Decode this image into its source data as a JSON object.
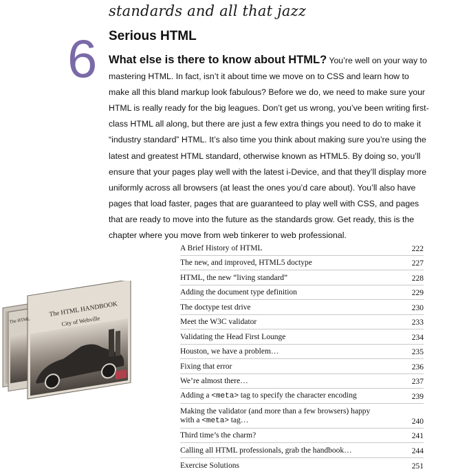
{
  "chapter": {
    "tagline": "standards and all that jazz",
    "number": "6",
    "title": "Serious HTML"
  },
  "intro": {
    "lead": "What else is there to know about HTML?",
    "body": " You’re well on your way to mastering HTML. In fact, isn’t it about time we move on to CSS and learn how to make all this bland markup look fabulous? Before we do, we need to make sure your HTML is really ready for the big leagues. Don’t get us wrong, you’ve been writing first-class HTML all along, but there are just a few extra things you need to do to make it “industry standard” HTML. It’s also time you think about making sure you’re using the latest and greatest HTML standard, otherwise known as HTML5. By doing so, you’ll ensure that your pages play well with the latest i-Device, and that they’ll display more uniformly across all browsers (at least the ones you’d care about). You’ll also have pages that load faster, pages that are guaranteed to play well with CSS, and pages that are ready to move into the future as the standards grow. Get ready, this is the chapter where you move from web tinkerer to web professional."
  },
  "book": {
    "title_line1": "The HTML HANDBOOK",
    "title_line2": "City of Webville",
    "spine": "The HTML"
  },
  "toc": [
    {
      "title": "A Brief History of HTML",
      "page": "222"
    },
    {
      "title": "The new, and improved, HTML5 doctype",
      "page": "227"
    },
    {
      "title": "HTML, the new “living standard”",
      "page": "228"
    },
    {
      "title": "Adding the document type definition",
      "page": "229"
    },
    {
      "title": "The doctype test drive",
      "page": "230"
    },
    {
      "title": "Meet the W3C validator",
      "page": "233"
    },
    {
      "title": "Validating the Head First Lounge",
      "page": "234"
    },
    {
      "title": "Houston, we have a problem…",
      "page": "235"
    },
    {
      "title": "Fixing that error",
      "page": "236"
    },
    {
      "title": "We’re almost there…",
      "page": "237"
    },
    {
      "title_pre": "Adding a ",
      "title_code": "<meta>",
      "title_post": " tag to specify the character encoding",
      "page": "239"
    },
    {
      "title_line1": "Making the validator (and more than a few browsers) happy",
      "title_pre": "with a ",
      "title_code": "<meta>",
      "title_post": " tag…",
      "page": "240"
    },
    {
      "title": "Third time’s the charm?",
      "page": "241"
    },
    {
      "title": "Calling all HTML professionals, grab the handbook…",
      "page": "244"
    },
    {
      "title": "Exercise Solutions",
      "page": "251"
    }
  ]
}
